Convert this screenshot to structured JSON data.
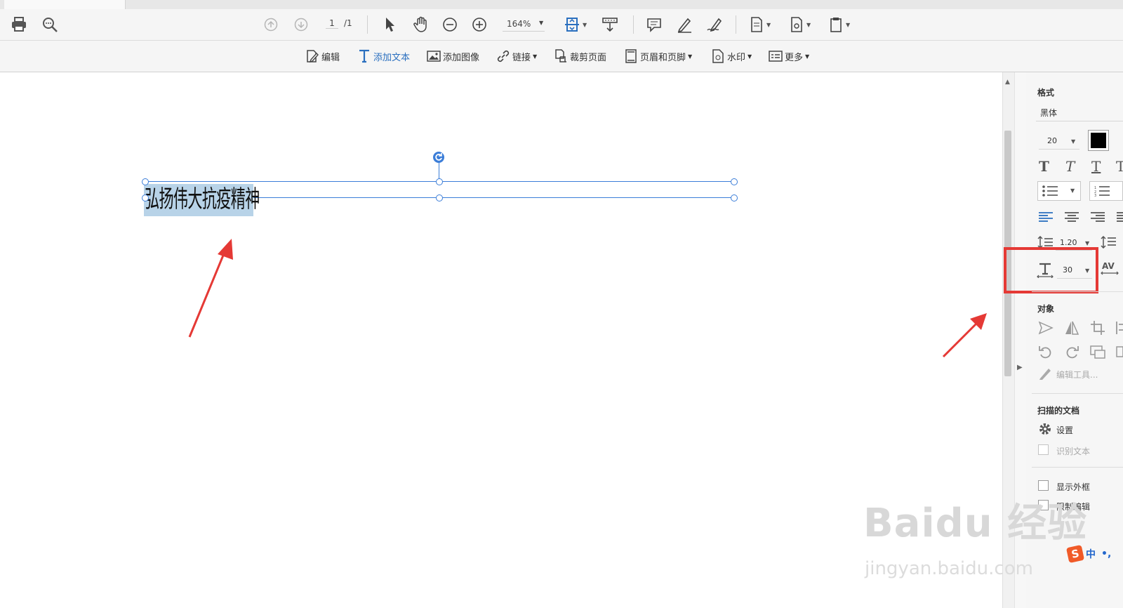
{
  "toolbar": {
    "page_current": "1",
    "page_total": "/1",
    "zoom": "164%"
  },
  "edit_toolbar": {
    "edit": "编辑",
    "add_text": "添加文本",
    "add_image": "添加图像",
    "link": "链接",
    "crop": "裁剪页面",
    "header_footer": "页眉和页脚",
    "watermark": "水印",
    "more": "更多"
  },
  "document": {
    "text": "弘扬伟大抗疫精神"
  },
  "panel": {
    "format_label": "格式",
    "font": "黑体",
    "font_size": "20",
    "font_color": "#000000",
    "line_spacing": "1.20",
    "char_scale": "30",
    "object_label": "对象",
    "edit_tool": "编辑工具...",
    "scanned_label": "扫描的文档",
    "settings": "设置",
    "recognize_text": "识别文本",
    "show_border": "显示外框",
    "restrict_edit": "限制编辑"
  },
  "watermark": {
    "brand": "Baidu 经验",
    "url": "jingyan.baidu.com"
  },
  "ime": {
    "mode": "中"
  },
  "colors": {
    "accent": "#2a6fbf",
    "annotation_red": "#e53935",
    "selection": "#b8d3e8"
  }
}
